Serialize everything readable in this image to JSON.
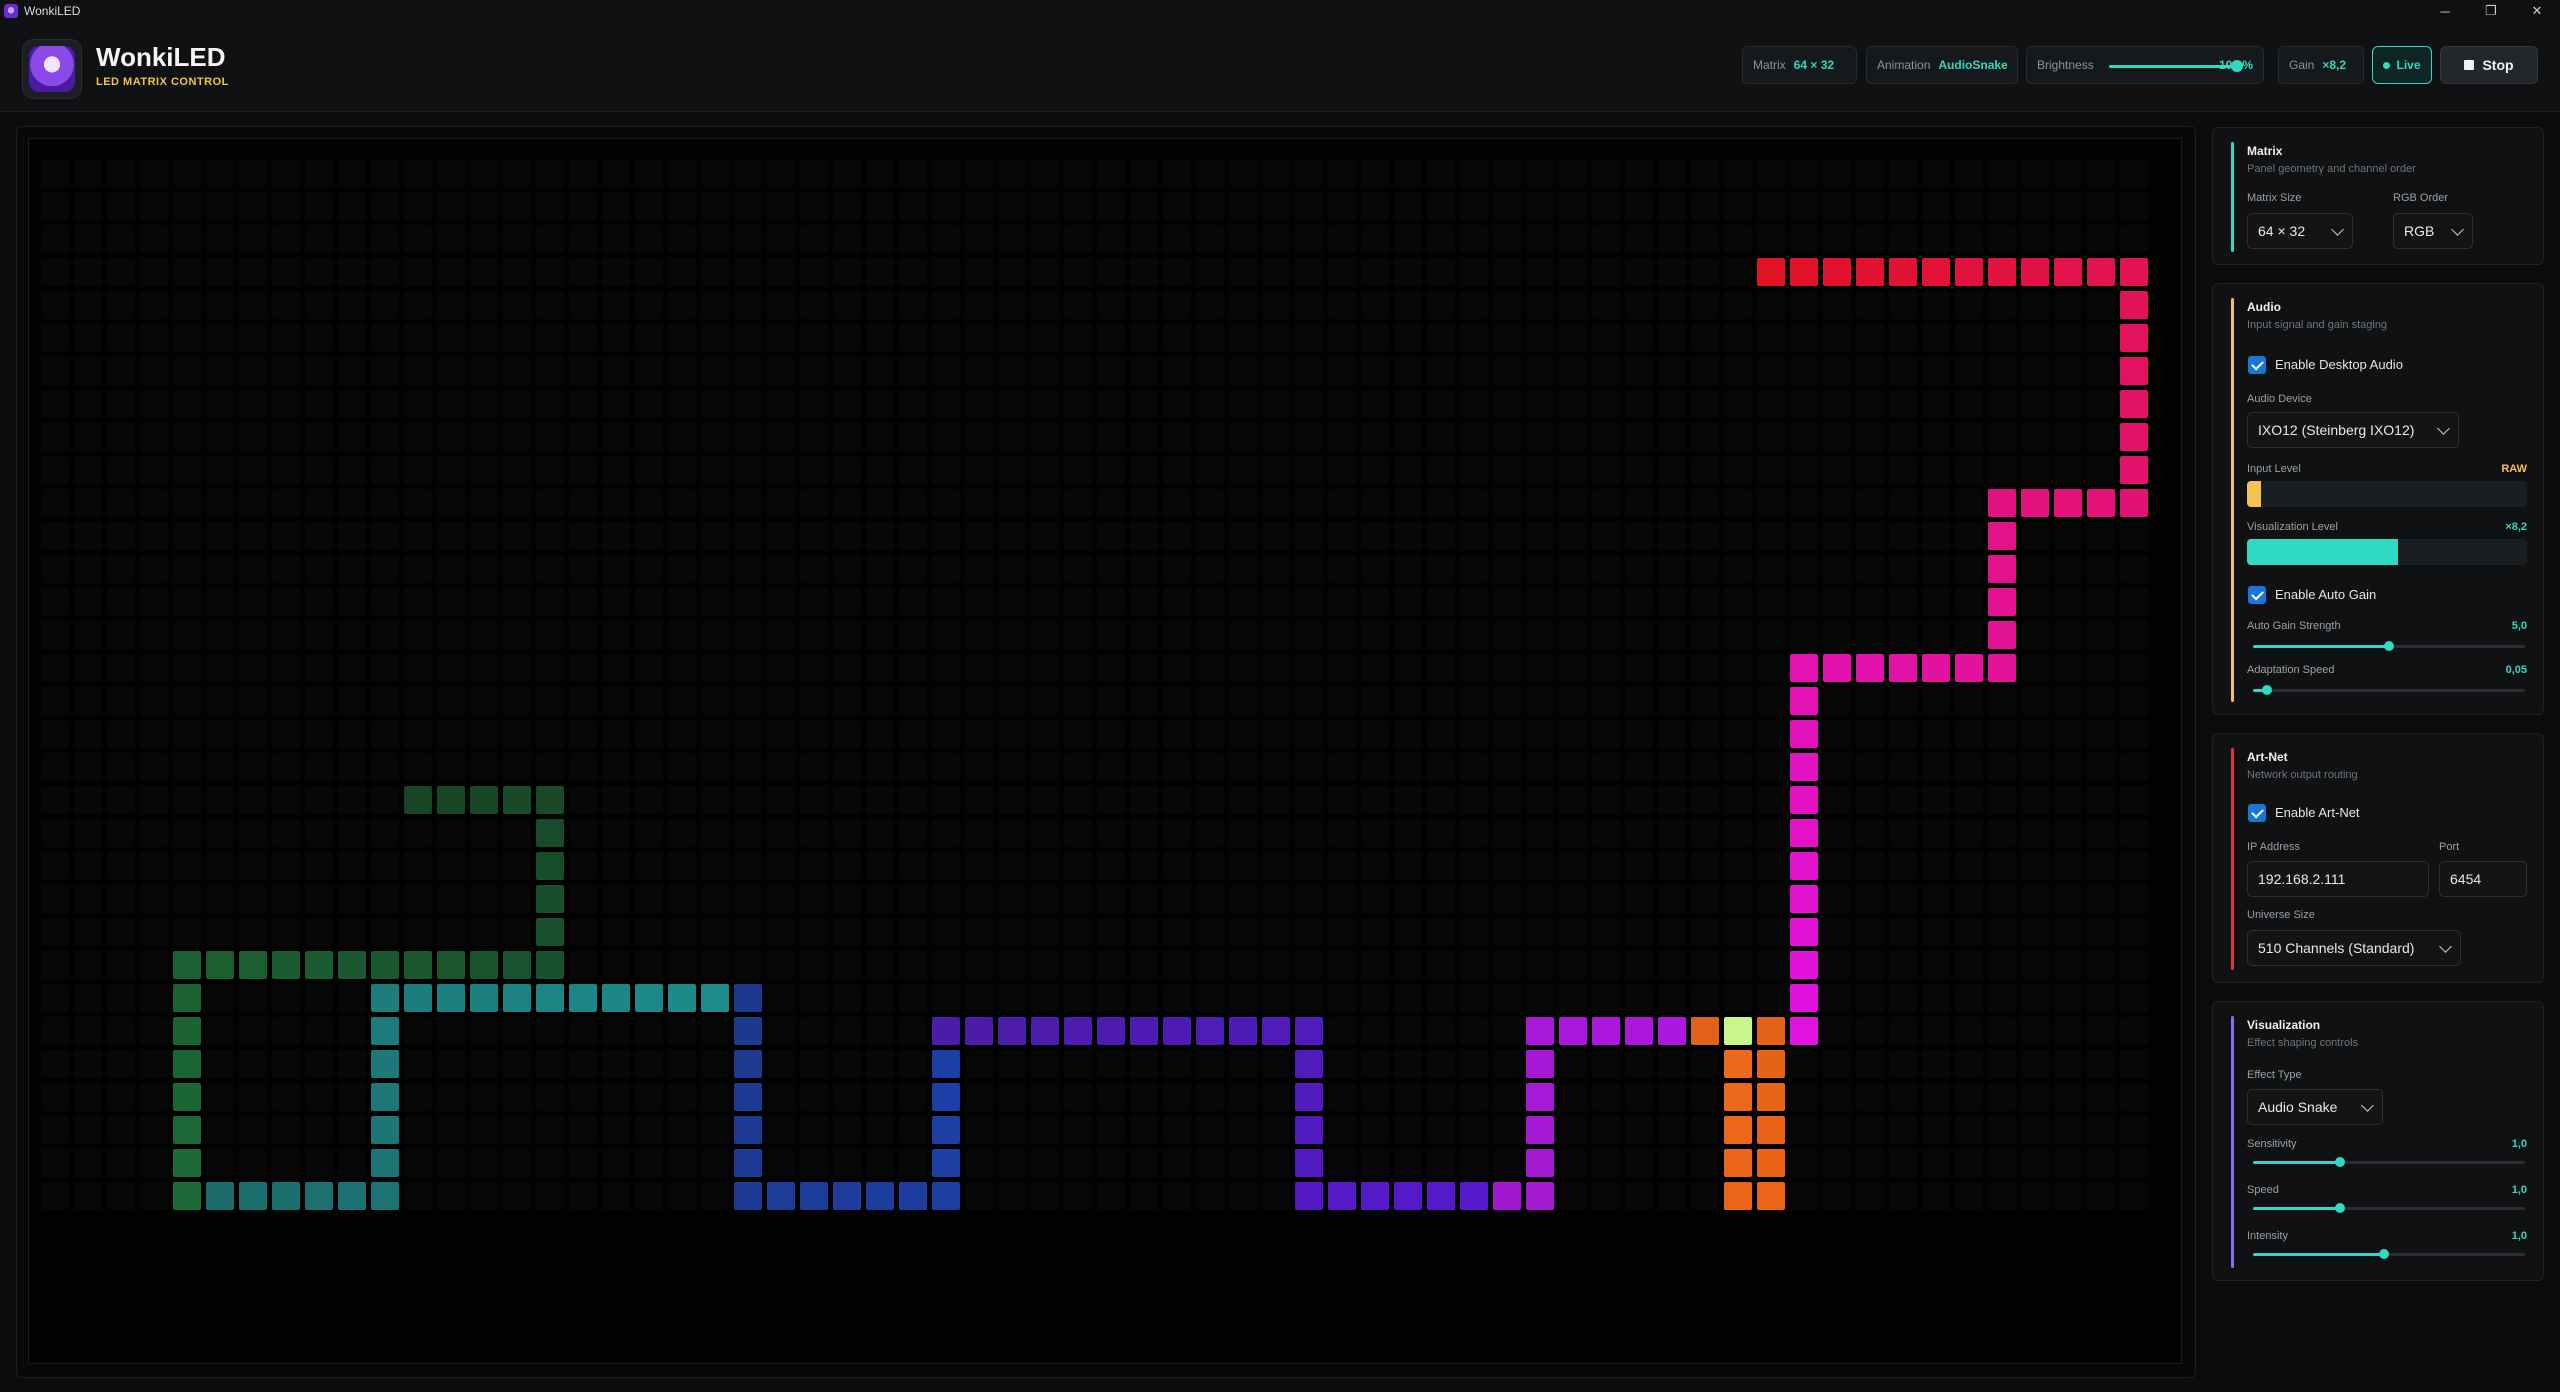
{
  "window": {
    "title": "WonkiLED",
    "minimize": "─",
    "maximize": "❐",
    "close": "✕"
  },
  "header": {
    "brand": "WonkiLED",
    "subtitle": "LED MATRIX CONTROL",
    "matrix_label": "Matrix",
    "matrix_value": "64 × 32",
    "animation_label": "Animation",
    "animation_value": "AudioSnake",
    "brightness_label": "Brightness",
    "brightness_value": "100 %",
    "brightness_level": 1.0,
    "gain_label": "Gain",
    "gain_value": "×8,2",
    "live_label": "Live",
    "stop_label": "Stop"
  },
  "matrix_panel": {
    "title": "Matrix",
    "subtitle": "Panel geometry and channel order",
    "size_label": "Matrix Size",
    "size_value": "64 × 32",
    "order_label": "RGB Order",
    "order_value": "RGB"
  },
  "audio_panel": {
    "title": "Audio",
    "subtitle": "Input signal and gain staging",
    "enable_label": "Enable Desktop Audio",
    "enable_checked": true,
    "device_label": "Audio Device",
    "device_value": "IXO12 (Steinberg IXO12)",
    "input_level_label": "Input Level",
    "input_level_tag": "RAW",
    "input_level": 0.05,
    "viz_level_label": "Visualization Level",
    "viz_level_tag": "×8,2",
    "viz_level": 0.54,
    "auto_gain_label": "Enable Auto Gain",
    "auto_gain_checked": true,
    "strength_label": "Auto Gain Strength",
    "strength_value": "5,0",
    "strength_level": 0.5,
    "speed_label": "Adaptation Speed",
    "speed_value": "0,05",
    "speed_level": 0.05
  },
  "artnet_panel": {
    "title": "Art-Net",
    "subtitle": "Network output routing",
    "enable_label": "Enable Art-Net",
    "enable_checked": true,
    "ip_label": "IP Address",
    "ip_value": "192.168.2.111",
    "port_label": "Port",
    "port_value": "6454",
    "universe_label": "Universe Size",
    "universe_value": "510 Channels (Standard)"
  },
  "viz_panel": {
    "title": "Visualization",
    "subtitle": "Effect shaping controls",
    "effect_label": "Effect Type",
    "effect_value": "Audio Snake",
    "sensitivity_label": "Sensitivity",
    "sensitivity_value": "1,0",
    "sensitivity_level": 0.32,
    "speed_label": "Speed",
    "speed_value": "1,0",
    "speed_level": 0.32,
    "intensity_label": "Intensity",
    "intensity_value": "1,0",
    "intensity_level": 0.48
  },
  "colors": {
    "accent": "#2fd9c4",
    "matrix_accent": "#2fd9c4",
    "audio_accent": "#f3c24f",
    "artnet_accent": "#e2324a",
    "viz_accent": "#8b6cf0"
  },
  "snake": {
    "cols": 64,
    "rows": 32,
    "head": [
      51,
      26
    ],
    "trail": [
      [
        51,
        27
      ],
      [
        51,
        28
      ],
      [
        51,
        29
      ],
      [
        51,
        30
      ],
      [
        51,
        31
      ],
      [
        52,
        31
      ],
      [
        52,
        30
      ],
      [
        52,
        29
      ],
      [
        52,
        28
      ],
      [
        52,
        27
      ],
      [
        52,
        26
      ],
      [
        50,
        26
      ],
      [
        49,
        26
      ],
      [
        48,
        26
      ],
      [
        47,
        26
      ],
      [
        46,
        26
      ],
      [
        45,
        26
      ],
      [
        45,
        27
      ],
      [
        45,
        28
      ],
      [
        45,
        29
      ],
      [
        45,
        30
      ],
      [
        45,
        31
      ],
      [
        44,
        31
      ],
      [
        43,
        31
      ],
      [
        42,
        31
      ],
      [
        41,
        31
      ],
      [
        40,
        31
      ],
      [
        39,
        31
      ],
      [
        38,
        31
      ],
      [
        38,
        30
      ],
      [
        38,
        29
      ],
      [
        38,
        28
      ],
      [
        38,
        27
      ],
      [
        38,
        26
      ],
      [
        37,
        26
      ],
      [
        36,
        26
      ],
      [
        35,
        26
      ],
      [
        34,
        26
      ],
      [
        33,
        26
      ],
      [
        32,
        26
      ],
      [
        31,
        26
      ],
      [
        30,
        26
      ],
      [
        29,
        26
      ],
      [
        28,
        26
      ],
      [
        27,
        26
      ],
      [
        27,
        27
      ],
      [
        27,
        28
      ],
      [
        27,
        29
      ],
      [
        27,
        30
      ],
      [
        27,
        31
      ],
      [
        26,
        31
      ],
      [
        25,
        31
      ],
      [
        24,
        31
      ],
      [
        23,
        31
      ],
      [
        22,
        31
      ],
      [
        21,
        31
      ],
      [
        21,
        30
      ],
      [
        21,
        29
      ],
      [
        21,
        28
      ],
      [
        21,
        27
      ],
      [
        21,
        26
      ],
      [
        21,
        25
      ],
      [
        20,
        25
      ],
      [
        19,
        25
      ],
      [
        18,
        25
      ],
      [
        17,
        25
      ],
      [
        16,
        25
      ],
      [
        15,
        25
      ],
      [
        14,
        25
      ],
      [
        13,
        25
      ],
      [
        12,
        25
      ],
      [
        11,
        25
      ],
      [
        10,
        25
      ],
      [
        10,
        26
      ],
      [
        10,
        27
      ],
      [
        10,
        28
      ],
      [
        10,
        29
      ],
      [
        10,
        30
      ],
      [
        10,
        31
      ],
      [
        9,
        31
      ],
      [
        8,
        31
      ],
      [
        7,
        31
      ],
      [
        6,
        31
      ],
      [
        5,
        31
      ],
      [
        4,
        31
      ],
      [
        4,
        30
      ],
      [
        4,
        29
      ],
      [
        4,
        28
      ],
      [
        4,
        27
      ],
      [
        4,
        26
      ],
      [
        4,
        25
      ],
      [
        4,
        24
      ],
      [
        5,
        24
      ],
      [
        6,
        24
      ],
      [
        7,
        24
      ],
      [
        8,
        24
      ],
      [
        9,
        24
      ],
      [
        10,
        24
      ],
      [
        11,
        24
      ],
      [
        12,
        24
      ],
      [
        13,
        24
      ],
      [
        14,
        24
      ],
      [
        15,
        24
      ],
      [
        15,
        23
      ],
      [
        15,
        22
      ],
      [
        15,
        21
      ],
      [
        15,
        20
      ],
      [
        15,
        19
      ],
      [
        14,
        19
      ],
      [
        13,
        19
      ],
      [
        12,
        19
      ],
      [
        11,
        19
      ]
    ],
    "body_up": [
      [
        53,
        26
      ],
      [
        53,
        25
      ],
      [
        53,
        24
      ],
      [
        53,
        23
      ],
      [
        53,
        22
      ],
      [
        53,
        21
      ],
      [
        53,
        20
      ],
      [
        53,
        19
      ],
      [
        53,
        18
      ],
      [
        53,
        17
      ],
      [
        53,
        16
      ],
      [
        53,
        15
      ],
      [
        54,
        15
      ],
      [
        55,
        15
      ],
      [
        56,
        15
      ],
      [
        57,
        15
      ],
      [
        58,
        15
      ],
      [
        59,
        15
      ],
      [
        59,
        14
      ],
      [
        59,
        13
      ],
      [
        59,
        12
      ],
      [
        59,
        11
      ],
      [
        59,
        10
      ],
      [
        60,
        10
      ],
      [
        61,
        10
      ],
      [
        62,
        10
      ],
      [
        63,
        10
      ],
      [
        63,
        9
      ],
      [
        63,
        8
      ],
      [
        63,
        7
      ],
      [
        63,
        6
      ],
      [
        63,
        5
      ],
      [
        63,
        4
      ],
      [
        63,
        3
      ],
      [
        62,
        3
      ],
      [
        61,
        3
      ],
      [
        60,
        3
      ],
      [
        59,
        3
      ],
      [
        58,
        3
      ],
      [
        57,
        3
      ],
      [
        56,
        3
      ],
      [
        55,
        3
      ],
      [
        54,
        3
      ],
      [
        53,
        3
      ],
      [
        52,
        3
      ]
    ]
  }
}
